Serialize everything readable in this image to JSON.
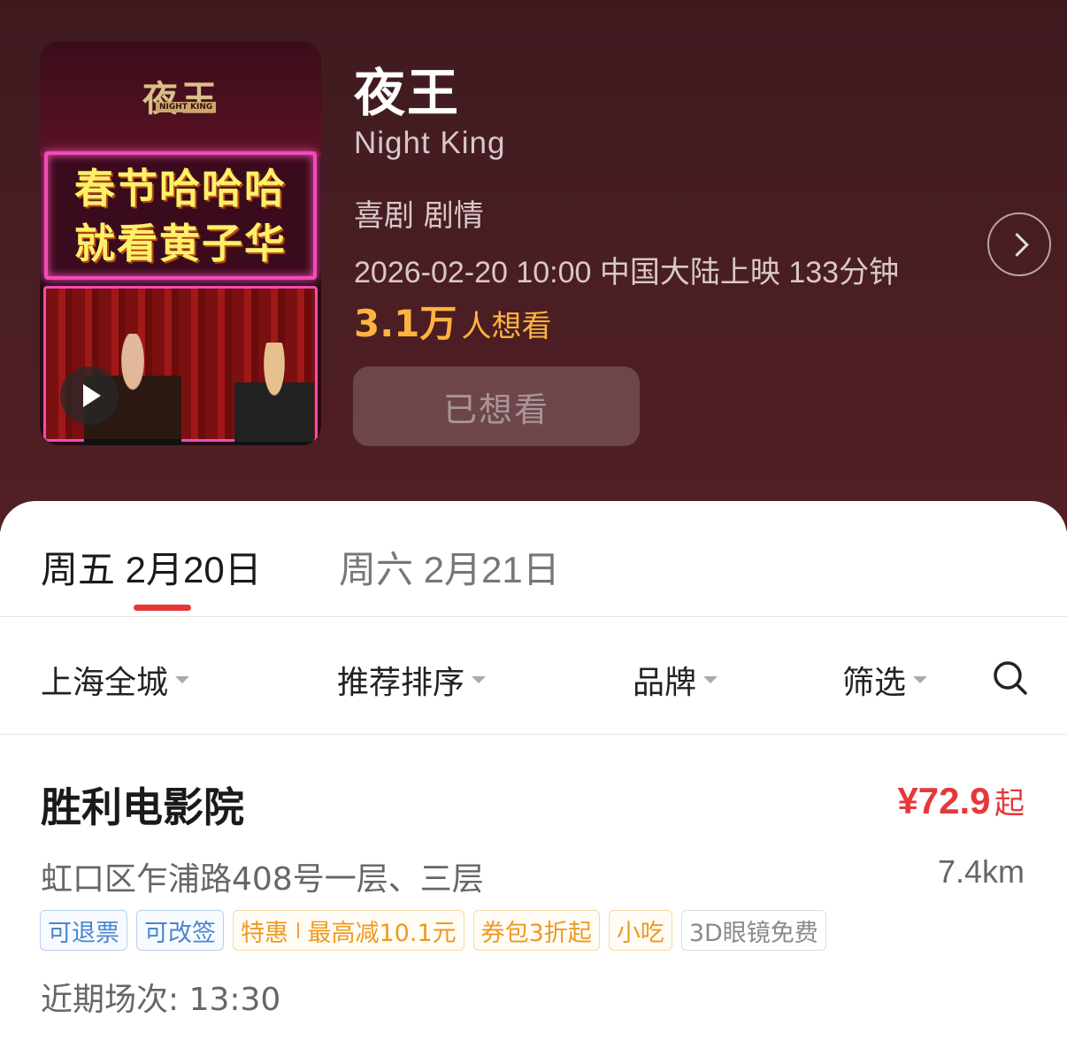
{
  "movie": {
    "title": "夜王",
    "english_title": "Night King",
    "genres": "喜剧 剧情",
    "release": "2026-02-20 10:00 中国大陆上映 133分钟",
    "want_count": "3.1万",
    "want_text": "人想看",
    "want_button_label": "已想看",
    "poster": {
      "logo_text": "夜王",
      "logo_sub": "NIGHT KING",
      "line1": "春节哈哈哈",
      "line2": "就看黄子华"
    }
  },
  "dates": [
    {
      "label": "周五 2月20日",
      "active": true
    },
    {
      "label": "周六 2月21日",
      "active": false
    }
  ],
  "filters": [
    {
      "label": "上海全城"
    },
    {
      "label": "推荐排序"
    },
    {
      "label": "品牌"
    },
    {
      "label": "筛选"
    }
  ],
  "cinema": {
    "name": "胜利电影院",
    "price": "¥72.9",
    "price_suffix": "起",
    "address": "虹口区乍浦路408号一层、三层",
    "distance": "7.4km",
    "tags": {
      "refund": "可退票",
      "change": "可改签",
      "deal_label": "特惠",
      "deal_detail": "最高减10.1元",
      "coupon": "券包3折起",
      "snack": "小吃",
      "glasses": "3D眼镜免费"
    },
    "showtimes": "近期场次: 13:30"
  },
  "colors": {
    "header_bg": "#4a1e23",
    "accent_red": "#e5383b",
    "want_orange": "#ffb33f",
    "tag_blue": "#4a86d0",
    "tag_orange": "#ee9a20"
  },
  "icons": {
    "play": "play-icon",
    "detail": "chevron-right-icon",
    "search": "search-icon",
    "dropdown": "caret-down-icon"
  }
}
